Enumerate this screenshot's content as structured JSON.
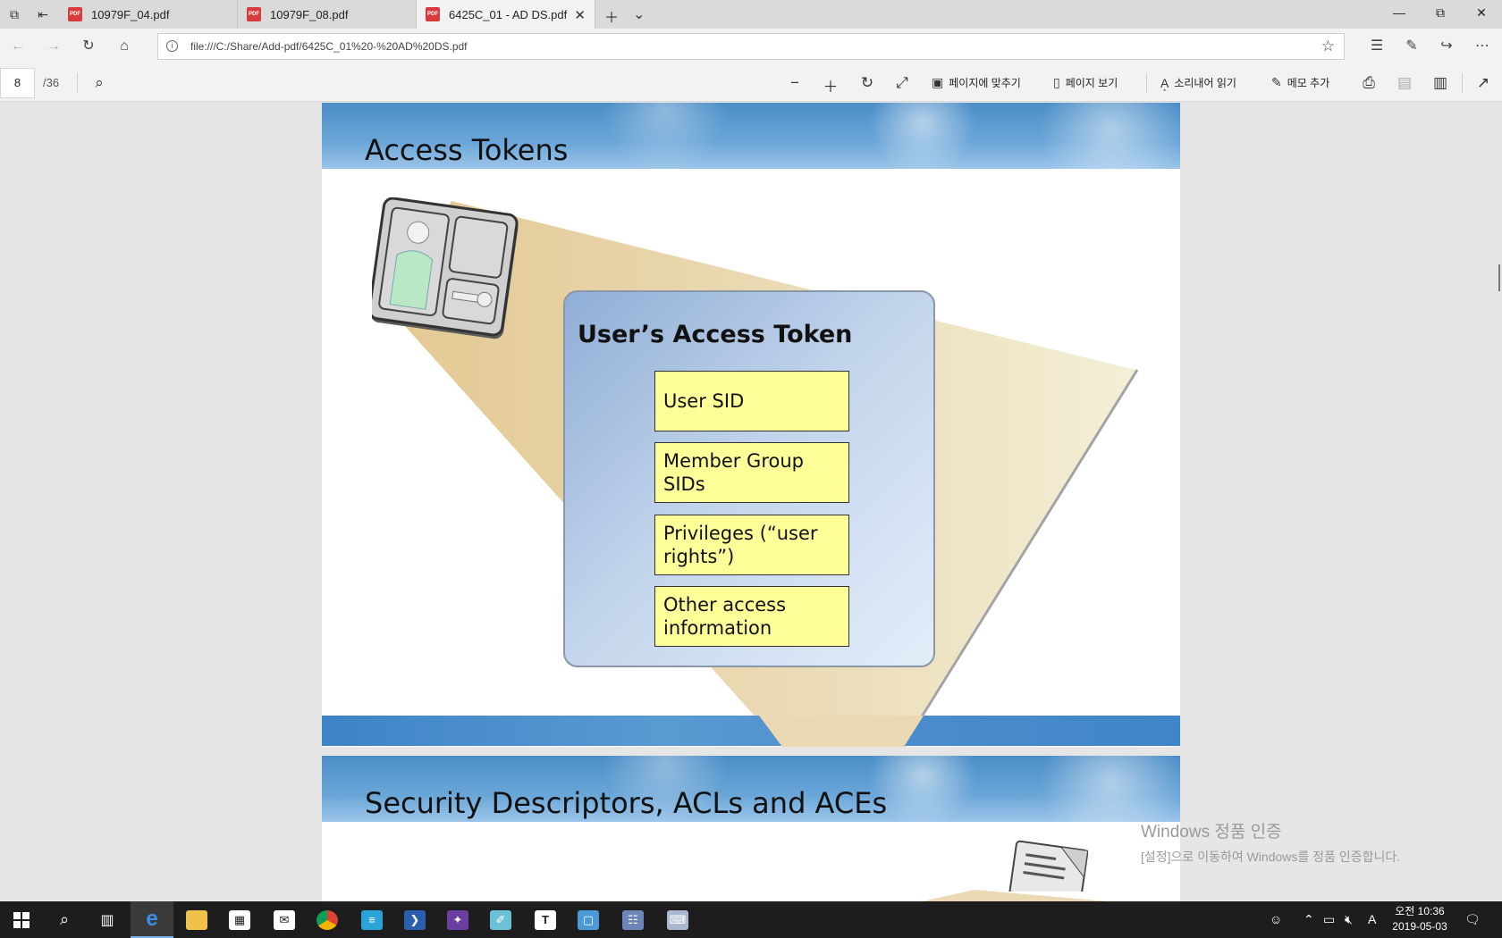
{
  "tabs": [
    {
      "label": "10979F_04.pdf",
      "active": false
    },
    {
      "label": "10979F_08.pdf",
      "active": false
    },
    {
      "label": "6425C_01 - AD DS.pdf",
      "active": true
    }
  ],
  "pdf_badge": "PDF",
  "address": {
    "url": "file:///C:/Share/Add-pdf/6425C_01%20-%20AD%20DS.pdf"
  },
  "pdf_toolbar": {
    "page_number": "8",
    "page_total": "/36",
    "fit_page": "페이지에 맞추기",
    "page_view": "페이지 보기",
    "read_aloud": "소리내어 읽기",
    "add_notes": "메모 추가"
  },
  "slides": [
    {
      "title": "Access Tokens",
      "token_title": "User’s Access Token",
      "items": [
        "User SID",
        "Member Group SIDs",
        "Privileges (“user rights”)",
        "Other access information"
      ]
    },
    {
      "title": "Security Descriptors, ACLs and ACEs"
    }
  ],
  "watermark": {
    "title": "Windows 정품 인증",
    "subtitle": "[설정]으로 이동하여 Windows를 정품 인증합니다."
  },
  "taskbar": {
    "ime": "A",
    "time": "오전 10:36",
    "date": "2019-05-03"
  },
  "colors": {
    "token_item_fill": "#ffff99",
    "banner_blue": "#4b8dc7",
    "pdf_icon_red": "#d83b3b"
  }
}
